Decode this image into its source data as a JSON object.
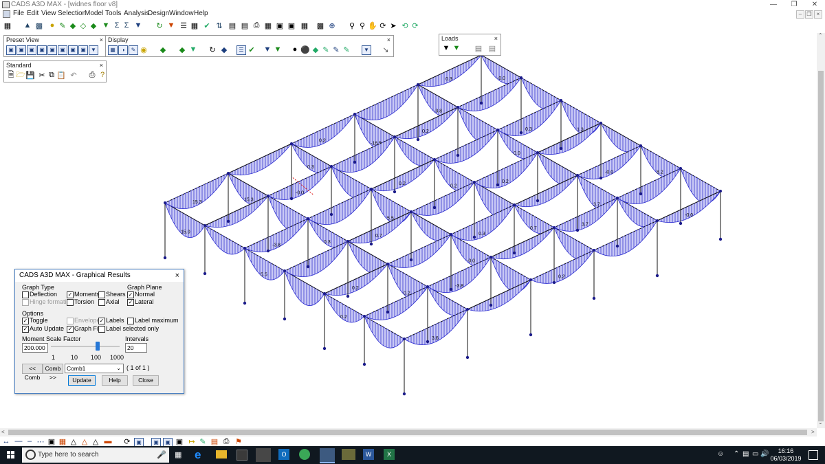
{
  "window": {
    "title": "CADS A3D MAX - [widnes floor v8]"
  },
  "menu": [
    "File",
    "Edit",
    "View",
    "Selection",
    "Model",
    "Tools",
    "Analysis",
    "Design",
    "Window",
    "Help"
  ],
  "panels": {
    "preset_view": {
      "title": "Preset View",
      "close": "×"
    },
    "standard": {
      "title": "Standard",
      "close": "×"
    },
    "display": {
      "title": "Display",
      "close": "×"
    },
    "loads": {
      "title": "Loads",
      "close": "×"
    }
  },
  "dialog": {
    "title": "CADS A3D MAX - Graphical Results",
    "close": "×",
    "graph_type": {
      "label": "Graph Type",
      "items": [
        {
          "label": "Deflection",
          "checked": false,
          "enabled": true
        },
        {
          "label": "Moments",
          "checked": true,
          "enabled": true
        },
        {
          "label": "Shears",
          "checked": false,
          "enabled": true
        },
        {
          "label": "Hinge formation",
          "checked": false,
          "enabled": false
        },
        {
          "label": "Torsion",
          "checked": false,
          "enabled": true
        },
        {
          "label": "Axial",
          "checked": false,
          "enabled": true
        }
      ]
    },
    "graph_plane": {
      "label": "Graph Plane",
      "items": [
        {
          "label": "Normal",
          "checked": true
        },
        {
          "label": "Lateral",
          "checked": true
        }
      ]
    },
    "options": {
      "label": "Options",
      "items": [
        {
          "label": "Toggle",
          "checked": true,
          "enabled": true
        },
        {
          "label": "Envelope",
          "checked": false,
          "enabled": false
        },
        {
          "label": "Labels",
          "checked": true,
          "enabled": true
        },
        {
          "label": "Label maximum",
          "checked": false,
          "enabled": true
        },
        {
          "label": "Auto Update",
          "checked": true,
          "enabled": true
        },
        {
          "label": "Graph Fills",
          "checked": true,
          "enabled": true
        },
        {
          "label": "Label selected only",
          "checked": false,
          "enabled": true
        }
      ]
    },
    "moment_scale": {
      "label": "Moment Scale Factor",
      "value": "200.000",
      "ticks": [
        "1",
        "10",
        "100",
        "1000"
      ],
      "slider_fraction": 0.69
    },
    "intervals": {
      "label": "Intervals",
      "value": "20"
    },
    "comb_prev": "<< Comb",
    "comb_next": "Comb >>",
    "comb_select": "Comb1",
    "comb_count": "( 1 of 1 )",
    "update": "Update",
    "help": "Help",
    "close_btn": "Close"
  },
  "taskbar": {
    "search_placeholder": "Type here to search",
    "time": "16:16",
    "date": "06/03/2019"
  },
  "model_labels": [
    "-0.0",
    "1.3",
    "8.2",
    "-3.8",
    "0.0",
    "3.7",
    "-16.5",
    "0.2",
    "0.7",
    "0.3",
    "5.5",
    "-0.0",
    "15.3",
    "0.3",
    "0.2",
    "15.0",
    "5.5",
    "0.2",
    "0.3",
    "0.2",
    "15.3",
    "0.2",
    "-0.0",
    "0.3",
    "0.2",
    "-3.8",
    "0.2",
    "0.7",
    "-0.0",
    "0.3",
    "0.2",
    "3.7",
    "-3.8",
    "-0.0",
    "0.2",
    "3.6",
    "0.2",
    "-0.0",
    "0.3",
    "0.2",
    "0.3",
    "0.2",
    "0.2",
    "15.0",
    "-0.0"
  ]
}
